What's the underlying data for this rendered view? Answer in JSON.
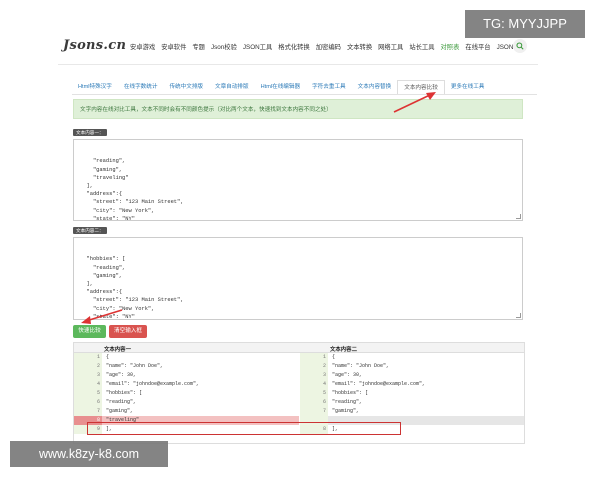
{
  "watermark_tg": "TG: MYYJJPP",
  "watermark_site": "www.k8zy-k8.com",
  "header": {
    "logo": "Jsons.cn",
    "nav": [
      "安卓游戏",
      "安卓软件",
      "专题",
      "Json校验",
      "JSON工具",
      "格式化转换",
      "加密编码",
      "文本转换",
      "网络工具",
      "站长工具",
      "对照表",
      "在线平台",
      "JSON教程"
    ],
    "active_nav_index": 10
  },
  "tabs": {
    "items": [
      "Html特殊汉字",
      "在线字数统计",
      "传统中文排版",
      "文章自动排版",
      "Html在线编辑器",
      "字符去重工具",
      "文本内容替换",
      "文本内容比较",
      "更多在线工具"
    ],
    "active_index": 7
  },
  "info_text": "文字内容在线对比工具，文本不同时会有不同颜色提示（对比两个文本，快速找到文本内容不同之处）",
  "text1": {
    "label": "文本内容一：",
    "content": "    \"reading\",\n    \"gaming\",\n    \"traveling\"\n  ],\n  \"address\":{\n    \"street\": \"123 Main Street\",\n    \"city\": \"New York\",\n    \"state\": \"NY\"\n  }\n}"
  },
  "text2": {
    "label": "文本内容二：",
    "content": "  \"hobbies\": [\n    \"reading\",\n    \"gaming\",\n  ],\n  \"address\":{\n    \"street\": \"123 Main Street\",\n    \"city\": \"New York\",\n    \"state\": \"NY\"\n  }\n}"
  },
  "buttons": {
    "compare": "快速比较",
    "clear": "清空输入框"
  },
  "compare": {
    "left_title": "文本内容一",
    "right_title": "文本内容二",
    "left_lines": [
      {
        "n": "1",
        "text": "{"
      },
      {
        "n": "2",
        "text": "\"name\": \"John Doe\","
      },
      {
        "n": "3",
        "text": "\"age\": 30,"
      },
      {
        "n": "4",
        "text": "\"email\": \"johndoe@example.com\","
      },
      {
        "n": "5",
        "text": "\"hobbies\": ["
      },
      {
        "n": "6",
        "text": "\"reading\","
      },
      {
        "n": "7",
        "text": "\"gaming\","
      },
      {
        "n": "8",
        "text": "\"traveling\""
      },
      {
        "n": "9",
        "text": "],"
      }
    ],
    "right_lines": [
      {
        "n": "1",
        "text": "{"
      },
      {
        "n": "2",
        "text": "\"name\": \"John Doe\","
      },
      {
        "n": "3",
        "text": "\"age\": 30,"
      },
      {
        "n": "4",
        "text": "\"email\": \"johndoe@example.com\","
      },
      {
        "n": "5",
        "text": "\"hobbies\": ["
      },
      {
        "n": "6",
        "text": "\"reading\","
      },
      {
        "n": "7",
        "text": "\"gaming\","
      },
      {
        "n": "",
        "text": ""
      },
      {
        "n": "8",
        "text": "],"
      }
    ],
    "diff_row_index": 7,
    "colors": {
      "deleted": "#f3c1c1",
      "gutter_deleted": "#e88f8f",
      "empty": "#e6e6e6",
      "gutter": "#edf5e2"
    }
  }
}
